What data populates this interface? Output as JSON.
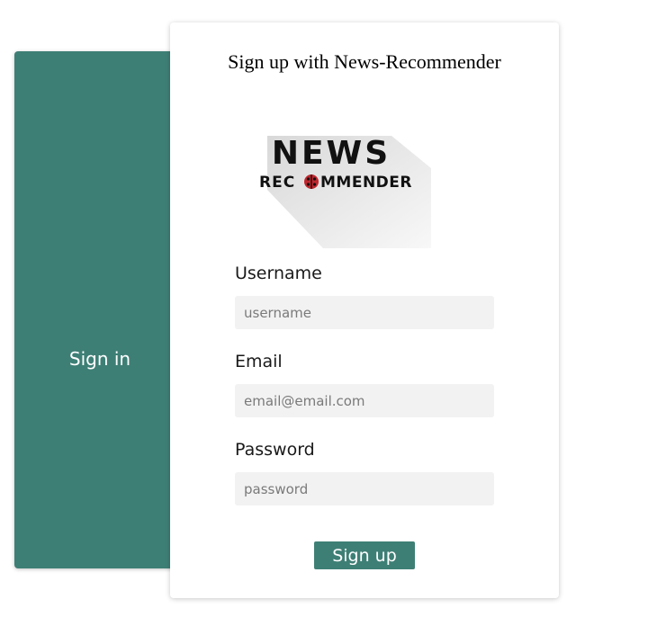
{
  "side_panel": {
    "link_label": "Sign in"
  },
  "form": {
    "title": "Sign up with News-Recommender",
    "logo": {
      "line1": "NEWS",
      "line2_before": "REC",
      "line2_after": "MMENDER"
    },
    "fields": [
      {
        "label": "Username",
        "placeholder": "username",
        "value": ""
      },
      {
        "label": "Email",
        "placeholder": "email@email.com",
        "value": ""
      },
      {
        "label": "Password",
        "placeholder": "password",
        "value": ""
      }
    ],
    "submit_label": "Sign up"
  },
  "colors": {
    "accent": "#3e7f75",
    "input_bg": "#f2f2f2",
    "logo_red": "#c0262d"
  }
}
